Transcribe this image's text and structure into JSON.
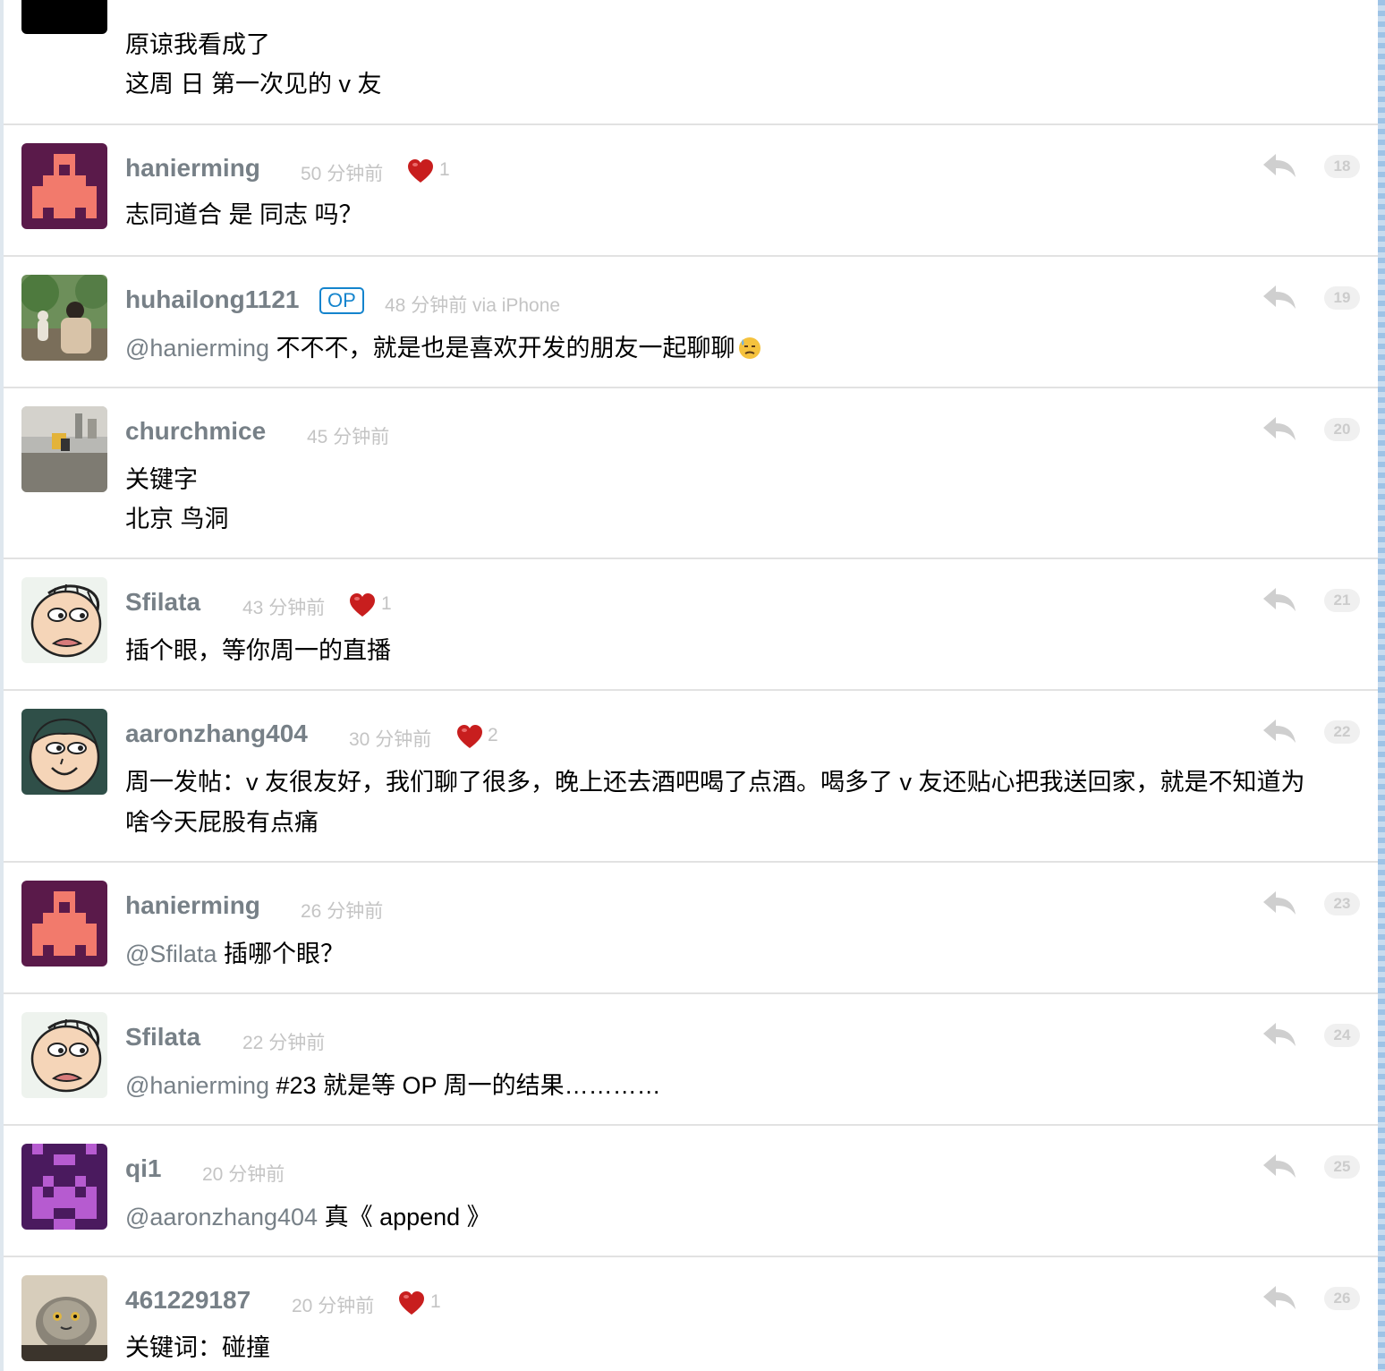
{
  "replies": [
    {
      "line1": "原谅我看成了",
      "line2": "这周 日 第一次见的 v 友"
    },
    {
      "user": "hanierming",
      "time": "50 分钟前",
      "likes": "1",
      "floor": "18",
      "content": "志同道合 是 同志 吗？"
    },
    {
      "user": "huhailong1121",
      "op": "OP",
      "time": "48 分钟前 via iPhone",
      "floor": "19",
      "mention": "@hanierming",
      "content": " 不不不，就是也是喜欢开发的朋友一起聊聊"
    },
    {
      "user": "churchmice",
      "time": "45 分钟前",
      "floor": "20",
      "line1": "关键字",
      "line2": "北京 鸟洞"
    },
    {
      "user": "Sfilata",
      "time": "43 分钟前",
      "likes": "1",
      "floor": "21",
      "content": "插个眼，等你周一的直播"
    },
    {
      "user": "aaronzhang404",
      "time": "30 分钟前",
      "likes": "2",
      "floor": "22",
      "line1": "周一发帖：v 友很友好，我们聊了很多，晚上还去酒吧喝了点酒。喝多了 v 友还贴心把我送回家，就是不知道为",
      "line2": "啥今天屁股有点痛"
    },
    {
      "user": "hanierming",
      "time": "26 分钟前",
      "floor": "23",
      "mention": "@Sfilata",
      "content": " 插哪个眼？"
    },
    {
      "user": "Sfilata",
      "time": "22 分钟前",
      "floor": "24",
      "mention": "@hanierming",
      "content": " #23 就是等 OP 周一的结果…………"
    },
    {
      "user": "qi1",
      "time": "20 分钟前",
      "floor": "25",
      "mention": "@aaronzhang404",
      "content": " 真《 append 》"
    },
    {
      "user": "461229187",
      "time": "20 分钟前",
      "likes": "1",
      "floor": "26",
      "content": "关键词：碰撞"
    }
  ]
}
